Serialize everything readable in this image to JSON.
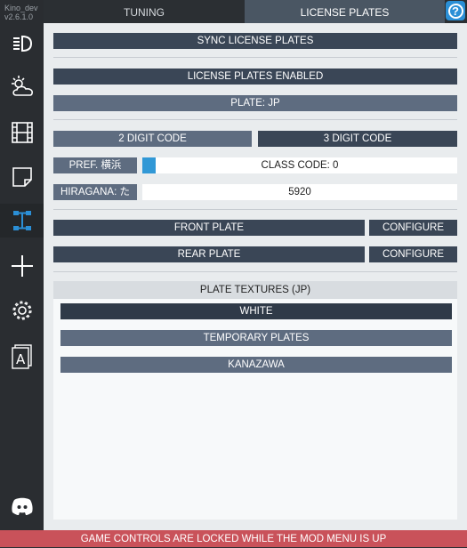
{
  "app": {
    "user": "Kino_dev",
    "version": "v2.6.1.0"
  },
  "tabs": [
    {
      "label": "TUNING",
      "active": false
    },
    {
      "label": "LICENSE PLATES",
      "active": true
    }
  ],
  "help_glyph": "?",
  "sidebar": {
    "icons": [
      "headlight-icon",
      "weather-icon",
      "film-icon",
      "note-icon",
      "tuning-icon",
      "add-icon",
      "settings-icon",
      "font-icon",
      "discord-icon"
    ],
    "active": "tuning-icon"
  },
  "license_plates": {
    "sync_label": "SYNC LICENSE PLATES",
    "enabled_label": "LICENSE PLATES ENABLED",
    "plate_label": "PLATE: JP",
    "two_digit_label": "2 DIGIT CODE",
    "three_digit_label": "3 DIGIT CODE",
    "prefecture_label": "PREF. 横浜",
    "class_code_label": "CLASS CODE: 0",
    "class_code_slider_level": 0,
    "hiragana_label": "HIRAGANA: た",
    "number_value": "5920",
    "front_plate_label": "FRONT PLATE",
    "front_configure_label": "CONFIGURE",
    "rear_plate_label": "REAR PLATE",
    "rear_configure_label": "CONFIGURE"
  },
  "textures": {
    "header": "PLATE TEXTURES (JP)",
    "items": [
      {
        "label": "WHITE",
        "selected": true
      },
      {
        "label": "TEMPORARY PLATES",
        "selected": false
      },
      {
        "label": "KANAZAWA",
        "selected": false
      }
    ]
  },
  "footer": {
    "message": "GAME CONTROLS ARE LOCKED WHILE THE MOD MENU IS UP"
  },
  "colors": {
    "accent": "#2b8fd6",
    "panel": "#e9ecee",
    "button": "#3a4656",
    "warning": "#c9525a"
  }
}
